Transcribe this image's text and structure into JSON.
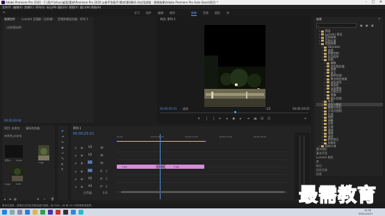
{
  "window": {
    "title": "Adobe Premiere Pro 2020 - C:\\用户\\lchun\\桌面\\素材\\Premiere Pro 2020 从新手到高手\\素材\\第6章\\6.4\\应用滤镜 - 视频效果\\Adobe Premiere Pro Auto-Save\\项目\\ *"
  },
  "menu": [
    "文件(F)",
    "编辑(E)",
    "剪辑(C)",
    "序列(S)",
    "标记(M)",
    "图形(G)",
    "视图(V)",
    "窗口(W)",
    "帮助(H)"
  ],
  "workspaces": {
    "items": [
      "学习",
      "组件",
      "编辑",
      "颜色",
      "效果",
      "音频",
      "图形",
      "库"
    ],
    "active_index": 4
  },
  "source_panel": {
    "tabs": [
      "效果控件",
      "Lumetri 范围",
      "源（无剪辑）",
      "音频剪辑混合器：序列 1"
    ],
    "header": "（无剪辑选择）",
    "timecode": "00:00:00:00"
  },
  "program_monitor": {
    "tab": "节目: 序列 1",
    "timecode_left": "00:00:05:01",
    "fit": "适合",
    "ratio": "1/2",
    "timecode_right": "00:00:10:01"
  },
  "effects_panel": {
    "tab": "效果",
    "search_placeholder": "",
    "tree": [
      {
        "label": "预设",
        "indent": 1
      },
      {
        "label": "Lumetri 预设",
        "indent": 1
      },
      {
        "label": "音频效果",
        "indent": 1
      },
      {
        "label": "音频过渡",
        "indent": 1
      },
      {
        "label": "视频效果",
        "indent": 1
      },
      {
        "label": "Obsolete",
        "indent": 2
      },
      {
        "label": "变换",
        "indent": 2
      },
      {
        "label": "图像控制",
        "indent": 2
      },
      {
        "label": "实用程序",
        "indent": 2
      },
      {
        "label": "扭曲",
        "indent": 2
      },
      {
        "label": "偏移",
        "indent": 3
      },
      {
        "label": "变形稳定器",
        "indent": 3
      },
      {
        "label": "变换",
        "indent": 3
      },
      {
        "label": "放大",
        "indent": 3
      },
      {
        "label": "旋转扭曲",
        "indent": 3
      },
      {
        "label": "果冻效应修复",
        "indent": 3
      },
      {
        "label": "波形变形",
        "indent": 3
      },
      {
        "label": "球面化",
        "indent": 3
      },
      {
        "label": "湍流置换",
        "indent": 3
      },
      {
        "label": "边角定位",
        "indent": 3
      },
      {
        "label": "镜像",
        "indent": 3
      },
      {
        "label": "镜头扭曲",
        "indent": 3
      },
      {
        "label": "时间",
        "indent": 2
      },
      {
        "label": "杂色与颗粒",
        "indent": 2
      },
      {
        "label": "模糊与锐化",
        "indent": 2
      },
      {
        "label": "沉浸式视频",
        "indent": 2
      },
      {
        "label": "生成",
        "indent": 2
      },
      {
        "label": "视频",
        "indent": 2
      },
      {
        "label": "调整",
        "indent": 2
      },
      {
        "label": "过时",
        "indent": 2
      },
      {
        "label": "过渡",
        "indent": 2
      },
      {
        "label": "透视",
        "indent": 2
      },
      {
        "label": "通道",
        "indent": 2
      },
      {
        "label": "键控",
        "indent": 2
      },
      {
        "label": "颜色校正",
        "indent": 2
      },
      {
        "label": "风格化",
        "indent": 2
      },
      {
        "label": "视频过渡",
        "indent": 1
      }
    ],
    "selected_index": 23,
    "lower_panels": [
      "基本图形",
      "基本声音",
      "Lumetri 颜色",
      "库",
      "标记",
      "历史记录",
      "信息"
    ]
  },
  "project_panel": {
    "tabs": [
      "项目: 未命名",
      "媒体浏览器"
    ],
    "project_name": "未命名.prproj",
    "items": [
      {
        "name": "未命名.prproj",
        "duration": ""
      },
      {
        "name": "序列 1",
        "duration": "10:01"
      },
      {
        "name": "1.jpg",
        "duration": ""
      },
      {
        "name": "2.jpg",
        "duration": "5:00"
      }
    ]
  },
  "timeline": {
    "tab": "序列 1",
    "timecode": "00:00:05:01",
    "ruler": [
      "00:00",
      "00:00:05:00",
      "00:00:10:00",
      "00:00:15:00",
      "00:00:20:00"
    ],
    "tracks": [
      {
        "id": "V3",
        "kind": "video"
      },
      {
        "id": "V2",
        "kind": "video"
      },
      {
        "id": "V1",
        "kind": "video"
      },
      {
        "id": "A1",
        "kind": "audio"
      },
      {
        "id": "A2",
        "kind": "audio"
      },
      {
        "id": "A3",
        "kind": "audio"
      }
    ],
    "master": "主声道",
    "master_value": "0.0",
    "clips": [
      {
        "label": "1.jpg"
      },
      {
        "label": "交叉溶解"
      },
      {
        "label": "2.jpg"
      }
    ]
  },
  "status": {
    "hint": "单击可选择，或单击空白处并拖动进行选择，用 Shift、Alt 和 Ctrl 可获得其他选项。"
  },
  "taskbar": {
    "time": "14:30",
    "date": "2021/10/11"
  },
  "watermark": "最需教育"
}
